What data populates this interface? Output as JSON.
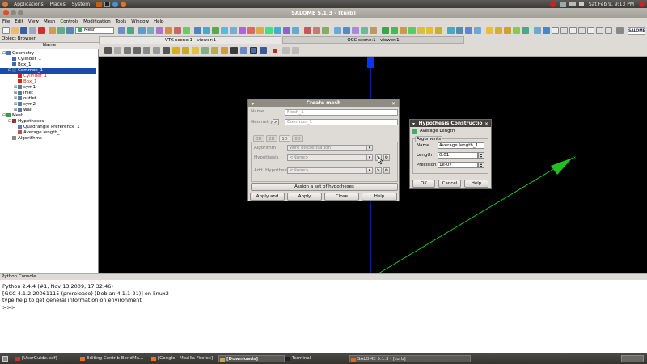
{
  "panel": {
    "menus": [
      "Applications",
      "Places",
      "System"
    ],
    "clock": "Sat Feb  9,  9:13 PM"
  },
  "window": {
    "title": "SALOME 5.1.3 - [turb]"
  },
  "menubar": [
    "File",
    "Edit",
    "View",
    "Mesh",
    "Controls",
    "Modification",
    "Tools",
    "Window",
    "Help"
  ],
  "toolbar": {
    "module_select": "Mesh",
    "logo": "SALOME 5"
  },
  "object_browser": {
    "header": "Object Browser",
    "column": "Name",
    "items": [
      {
        "label": "Geometry",
        "indent": 0,
        "color": "#000"
      },
      {
        "label": "Cylinder_1",
        "indent": 1,
        "color": "#000"
      },
      {
        "label": "Box_1",
        "indent": 1,
        "color": "#000"
      },
      {
        "label": "Common_1",
        "indent": 1,
        "color": "#fff",
        "selected": true
      },
      {
        "label": "Cylinder_1",
        "indent": 2,
        "color": "#e02020"
      },
      {
        "label": "Box_1",
        "indent": 2,
        "color": "#e02020"
      },
      {
        "label": "sym1",
        "indent": 2,
        "color": "#000"
      },
      {
        "label": "inlet",
        "indent": 2,
        "color": "#000"
      },
      {
        "label": "outlet",
        "indent": 2,
        "color": "#000"
      },
      {
        "label": "sym2",
        "indent": 2,
        "color": "#000"
      },
      {
        "label": "wall",
        "indent": 2,
        "color": "#000"
      },
      {
        "label": "Mesh",
        "indent": 0,
        "color": "#000"
      },
      {
        "label": "Hypotheses",
        "indent": 1,
        "color": "#000"
      },
      {
        "label": "Quadrangle Preference_1",
        "indent": 2,
        "color": "#000"
      },
      {
        "label": "Average length_1",
        "indent": 2,
        "color": "#000"
      },
      {
        "label": "Algorithms",
        "indent": 1,
        "color": "#000"
      }
    ]
  },
  "viewer_tabs": [
    "VTK scene:1 - viewer:1",
    "OCC scene:1 - viewer:1"
  ],
  "create_mesh": {
    "title": "Create mesh",
    "name_label": "Name",
    "name_value": "Mesh_1",
    "geometry_label": "Geometry",
    "geometry_value": "Common_1",
    "dim_tabs": [
      "3D",
      "2D",
      "1D",
      "0D"
    ],
    "algorithm_label": "Algorithm",
    "algorithm_value": "Wire discretisation",
    "hypothesis_label": "Hypothesis",
    "hypothesis_value": "<None>",
    "add_hypothesis_label": "Add. Hypothesis",
    "add_hypothesis_value": "<None>",
    "assign_set_button": "Assign a set of hypotheses",
    "apply_close_button": "Apply and Close",
    "apply_button": "Apply",
    "close_button": "Close",
    "help_button": "Help"
  },
  "hypothesis_dialog": {
    "title": "Hypothesis Constructio",
    "heading": "Average Length",
    "group": "Arguments",
    "name_label": "Name",
    "name_value": "Average length_1",
    "length_label": "Length",
    "length_value": "0.01",
    "precision_label": "Precision",
    "precision_value": "1e-07",
    "ok_button": "OK",
    "cancel_button": "Cancel",
    "help_button": "Help"
  },
  "console": {
    "header": "Python Console",
    "lines": [
      "Python 2.4.4 (#1, Nov 13 2009, 17:32:46)",
      "[GCC 4.1.2 20061115 (prerelease) (Debian 4.1.1-21)] on linux2",
      "type help to get general information on environment",
      ">>>"
    ]
  },
  "taskbar": [
    "[UserGuide.pdf]",
    "Editing Contrib BondMa...",
    "[Google - Mozilla Firefox]",
    "[Downloads]",
    "Terminal",
    "SALOME 5.1.3 - [turb]"
  ],
  "colors": {
    "selection": "#1a4aa8",
    "dialog_title": "#8f8c84",
    "axis_blue": "#1030ff",
    "axis_green": "#20c020"
  }
}
